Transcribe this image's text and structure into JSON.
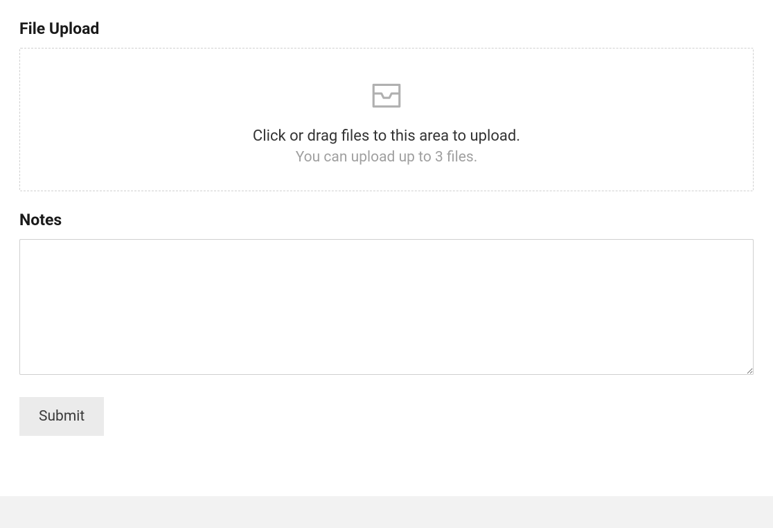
{
  "fileUpload": {
    "label": "File Upload",
    "primaryText": "Click or drag files to this area to upload.",
    "secondaryText": "You can upload up to 3 files."
  },
  "notes": {
    "label": "Notes",
    "value": ""
  },
  "submit": {
    "label": "Submit"
  }
}
